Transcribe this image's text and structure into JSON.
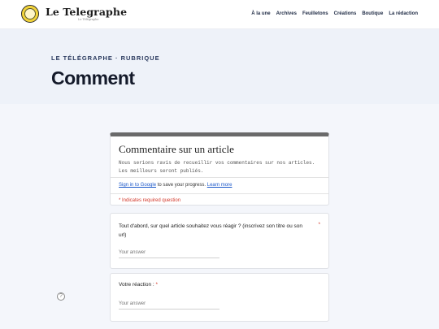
{
  "header": {
    "logo_text": "Le Telegraphe",
    "logo_sub": "Le Télégraphe",
    "nav": [
      "À la une",
      "Archives",
      "Feuilletons",
      "Créations",
      "Boutique",
      "La rédaction"
    ]
  },
  "hero": {
    "kicker": "LE TÉLÉGRAPHE · RUBRIQUE",
    "title": "Comment"
  },
  "form": {
    "title": "Commentaire sur un article",
    "description": "Nous serions ravis de recueillir vos commentaires sur nos articles. Les meilleurs seront publiés.",
    "signin_link": "Sign in to Google",
    "signin_text": " to save your progress. ",
    "learn_more": "Learn more",
    "required_note": "* Indicates required question",
    "questions": [
      {
        "label": "Tout d'abord, sur quel article souhaitez vous réagir ? (inscrivez son titre ou son url)",
        "required_mark": "*",
        "placeholder": "Your answer"
      },
      {
        "label": "Votre réaction : ",
        "required_mark": "*",
        "placeholder": "Your answer"
      }
    ]
  },
  "help": {
    "glyph": "?"
  },
  "colors": {
    "accent_bar": "#6a6a6a",
    "required": "#d33a2c",
    "link": "#1a57c9"
  }
}
